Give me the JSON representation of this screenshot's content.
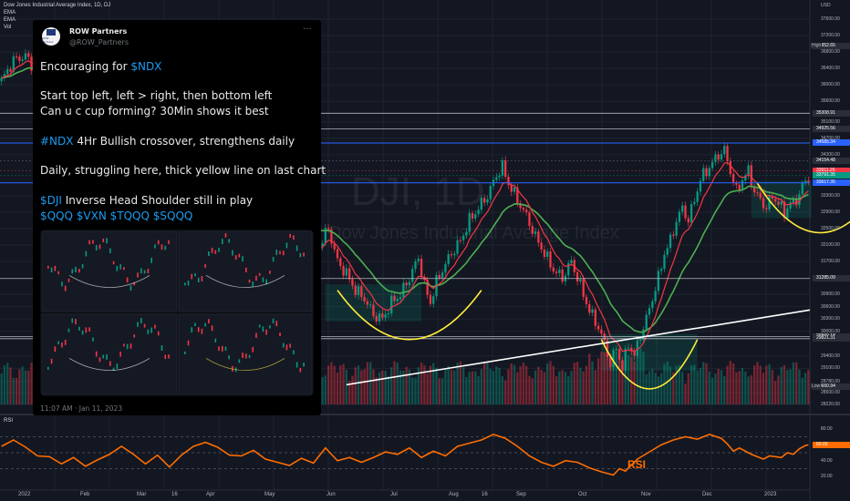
{
  "header": {
    "title": "Dow Jones Industrial Average Index, 1D, DJ",
    "indicators": [
      "EMA",
      "EMA",
      "Vol"
    ],
    "currency": "USD"
  },
  "watermark": {
    "symbol": "DJI, 1D",
    "name": "Dow Jones Industrial Average Index"
  },
  "tweet": {
    "name": "ROW Partners",
    "handle": "@ROW_Partners",
    "avatar_text": "ROW Partners",
    "more": "···",
    "lines": [
      [
        {
          "t": "Encouraging for "
        },
        {
          "t": "$NDX",
          "tag": true
        }
      ],
      [
        {
          "t": "Start top left, left > right, then bottom left"
        }
      ],
      [
        {
          "t": "Can u c cup forming? 30Min shows it best"
        }
      ],
      [
        {
          "t": "#NDX",
          "tag": true
        },
        {
          "t": " 4Hr Bullish crossover, strengthens daily"
        }
      ],
      [
        {
          "t": "Daily, struggling here, thick yellow line on last chart"
        }
      ],
      [
        {
          "t": "$DJI",
          "tag": true
        },
        {
          "t": " Inverse Head Shoulder still in play"
        }
      ],
      [
        {
          "t": "$QQQ $VXN $TQQQ $SQQQ",
          "tag": true
        }
      ]
    ],
    "time": "11:07 AM · Jan 11, 2023"
  },
  "price_axis": {
    "ticks": [
      37600,
      37200,
      36800,
      36400,
      36000,
      35600,
      35100,
      34700,
      34300,
      33300,
      32900,
      32500,
      32100,
      31700,
      30900,
      30600,
      30300,
      30000,
      29400,
      29100,
      28780,
      28500,
      28220
    ],
    "tick_labels": [
      "37600.00",
      "37200.00",
      "36800.00",
      "36400.00",
      "36000.00",
      "35600.00",
      "35100.00",
      "34700.00",
      "34300.00",
      "33300.00",
      "32900.00",
      "32500.00",
      "32100.00",
      "31700.00",
      "30900.00",
      "30600.00",
      "30300.00",
      "30000.00",
      "29400.00",
      "29100.00",
      "28780.00",
      "28500.00",
      "28220.00"
    ],
    "high_label": "High",
    "high_value": "36952.65",
    "low_label": "Low",
    "low_value": "28660.94",
    "price_boxes": [
      {
        "label": "35308.91",
        "price": 35309,
        "color": "#2a2e39",
        "line": "#d1d4dc"
      },
      {
        "label": "34925.56",
        "price": 34926,
        "color": "#2a2e39",
        "line": "#d1d4dc"
      },
      {
        "label": "34585.34",
        "price": 34585,
        "color": "#2962ff",
        "line": "#2962ff"
      },
      {
        "label": "34154.48",
        "price": 34154,
        "color": "#2a2e39",
        "line": "#787b86"
      },
      {
        "label": "33911.26",
        "price": 33911,
        "color": "#f23645",
        "line": "#f23645"
      },
      {
        "label": "33791.35",
        "price": 33791,
        "color": "#089981",
        "line": "#089981"
      },
      {
        "label": "33617.35",
        "price": 33617,
        "color": "#2962ff",
        "line": "#2962ff"
      },
      {
        "label": "31285.09",
        "price": 31285,
        "color": "#2a2e39",
        "line": "#d1d4dc"
      },
      {
        "label": "29869.18",
        "price": 29869,
        "color": "#2a2e39",
        "line": "#d1d4dc"
      },
      {
        "label": "29821.31",
        "price": 29821,
        "color": "#2a2e39",
        "line": "#d1d4dc"
      }
    ]
  },
  "time_axis": {
    "labels": [
      "2022",
      "Feb",
      "Mar",
      "16",
      "Apr",
      "May",
      "Jun",
      "Jul",
      "Aug",
      "16",
      "Sep",
      "Oct",
      "Nov",
      "Dec",
      "2023"
    ]
  },
  "chart_data": {
    "type": "candlestick",
    "title": "Dow Jones Industrial Average Index, 1D, DJ",
    "ylim": [
      28220,
      37800
    ],
    "grid": true,
    "price_path": [
      [
        0,
        36100
      ],
      [
        4,
        36600
      ],
      [
        8,
        36700
      ],
      [
        13,
        36200
      ],
      [
        18,
        35700
      ],
      [
        23,
        35200
      ],
      [
        27,
        34900
      ],
      [
        31,
        34500
      ],
      [
        35,
        33800
      ],
      [
        38,
        33600
      ],
      [
        41,
        34200
      ],
      [
        44,
        34600
      ],
      [
        46,
        33900
      ],
      [
        50,
        33400
      ],
      [
        53,
        33000
      ],
      [
        57,
        32700
      ],
      [
        60,
        33200
      ],
      [
        63,
        33500
      ],
      [
        67,
        34300
      ],
      [
        70,
        34700
      ],
      [
        73,
        35000
      ],
      [
        76,
        34600
      ],
      [
        79,
        34000
      ],
      [
        82,
        33600
      ],
      [
        85,
        34100
      ],
      [
        88,
        33300
      ],
      [
        91,
        33000
      ],
      [
        94,
        32700
      ],
      [
        97,
        32100
      ],
      [
        100,
        32200
      ],
      [
        103,
        31600
      ],
      [
        106,
        32100
      ],
      [
        109,
        32500
      ],
      [
        112,
        31700
      ],
      [
        115,
        31400
      ],
      [
        118,
        31000
      ],
      [
        121,
        30800
      ],
      [
        124,
        30400
      ],
      [
        127,
        30300
      ],
      [
        130,
        30700
      ],
      [
        133,
        30900
      ],
      [
        136,
        31300
      ],
      [
        139,
        31800
      ],
      [
        141,
        31100
      ],
      [
        143,
        30700
      ],
      [
        145,
        31200
      ],
      [
        147,
        31500
      ],
      [
        150,
        31900
      ],
      [
        153,
        32200
      ],
      [
        156,
        32700
      ],
      [
        159,
        33000
      ],
      [
        162,
        33300
      ],
      [
        165,
        33800
      ],
      [
        167,
        34000
      ],
      [
        169,
        33600
      ],
      [
        172,
        33200
      ],
      [
        175,
        32800
      ],
      [
        178,
        32300
      ],
      [
        181,
        31900
      ],
      [
        184,
        31500
      ],
      [
        187,
        31300
      ],
      [
        190,
        31700
      ],
      [
        193,
        31100
      ],
      [
        196,
        30500
      ],
      [
        199,
        30100
      ],
      [
        201,
        29700
      ],
      [
        203,
        29200
      ],
      [
        205,
        29600
      ],
      [
        207,
        29100
      ],
      [
        209,
        29700
      ],
      [
        211,
        29400
      ],
      [
        213,
        29900
      ],
      [
        215,
        30300
      ],
      [
        217,
        30800
      ],
      [
        219,
        31300
      ],
      [
        221,
        31900
      ],
      [
        223,
        32200
      ],
      [
        225,
        32700
      ],
      [
        227,
        33000
      ],
      [
        229,
        32700
      ],
      [
        231,
        33200
      ],
      [
        233,
        33700
      ],
      [
        235,
        33900
      ],
      [
        237,
        34100
      ],
      [
        239,
        34300
      ],
      [
        241,
        34400
      ],
      [
        243,
        33900
      ],
      [
        245,
        33400
      ],
      [
        247,
        33700
      ],
      [
        249,
        33900
      ],
      [
        251,
        33400
      ],
      [
        253,
        33200
      ],
      [
        255,
        33000
      ],
      [
        257,
        33300
      ],
      [
        259,
        33100
      ],
      [
        261,
        32900
      ],
      [
        263,
        33100
      ],
      [
        265,
        33200
      ],
      [
        267,
        33500
      ],
      [
        268,
        33700
      ],
      [
        269,
        33700
      ]
    ],
    "rsi": {
      "title": "RSI",
      "label": "RSI",
      "ticks": [
        80,
        60,
        40,
        20
      ],
      "tick_labels": [
        "80.00",
        "60.00",
        "40.00",
        "20.00"
      ],
      "bands": [
        70,
        50,
        30
      ],
      "values": [
        [
          0,
          58
        ],
        [
          4,
          66
        ],
        [
          8,
          57
        ],
        [
          12,
          46
        ],
        [
          16,
          45
        ],
        [
          20,
          36
        ],
        [
          24,
          44
        ],
        [
          28,
          33
        ],
        [
          32,
          41
        ],
        [
          36,
          48
        ],
        [
          40,
          58
        ],
        [
          44,
          48
        ],
        [
          48,
          36
        ],
        [
          52,
          47
        ],
        [
          56,
          32
        ],
        [
          60,
          47
        ],
        [
          64,
          58
        ],
        [
          68,
          63
        ],
        [
          72,
          57
        ],
        [
          76,
          47
        ],
        [
          80,
          46
        ],
        [
          84,
          53
        ],
        [
          88,
          42
        ],
        [
          92,
          38
        ],
        [
          96,
          34
        ],
        [
          100,
          43
        ],
        [
          104,
          37
        ],
        [
          108,
          56
        ],
        [
          112,
          40
        ],
        [
          116,
          44
        ],
        [
          120,
          38
        ],
        [
          124,
          44
        ],
        [
          128,
          51
        ],
        [
          132,
          48
        ],
        [
          136,
          56
        ],
        [
          140,
          44
        ],
        [
          144,
          52
        ],
        [
          148,
          46
        ],
        [
          152,
          58
        ],
        [
          156,
          62
        ],
        [
          160,
          66
        ],
        [
          164,
          73
        ],
        [
          168,
          68
        ],
        [
          172,
          58
        ],
        [
          176,
          46
        ],
        [
          180,
          38
        ],
        [
          184,
          33
        ],
        [
          188,
          40
        ],
        [
          192,
          38
        ],
        [
          196,
          31
        ],
        [
          200,
          26
        ],
        [
          204,
          22
        ],
        [
          206,
          30
        ],
        [
          208,
          27
        ],
        [
          212,
          42
        ],
        [
          216,
          51
        ],
        [
          220,
          60
        ],
        [
          224,
          66
        ],
        [
          228,
          70
        ],
        [
          232,
          67
        ],
        [
          236,
          73
        ],
        [
          240,
          68
        ],
        [
          242,
          61
        ],
        [
          244,
          52
        ],
        [
          246,
          56
        ],
        [
          250,
          48
        ],
        [
          254,
          42
        ],
        [
          256,
          46
        ],
        [
          260,
          44
        ],
        [
          262,
          50
        ],
        [
          264,
          48
        ],
        [
          266,
          55
        ],
        [
          268,
          59
        ],
        [
          269,
          60
        ]
      ]
    }
  },
  "colors": {
    "background": "#131722",
    "grid": "#1f2331",
    "candle_up": "#089981",
    "candle_down": "#f23645",
    "ema_fast": "#f23645",
    "ema_slow": "#4caf50",
    "trend_line": "#ffffff",
    "cup_curve": "#ffeb3b",
    "rsi_line": "#ff6d00",
    "level_line": "#2962ff"
  }
}
